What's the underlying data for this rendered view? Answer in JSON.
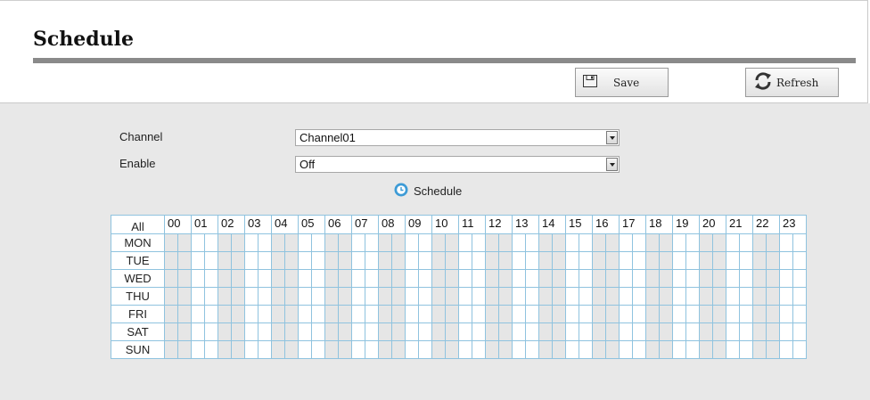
{
  "page": {
    "title": "Schedule"
  },
  "toolbar": {
    "save_label": "Save",
    "save_icon": "floppy-disk-icon",
    "refresh_label": "Refresh",
    "refresh_icon": "refresh-icon"
  },
  "form": {
    "channel": {
      "label": "Channel",
      "value": "Channel01"
    },
    "enable": {
      "label": "Enable",
      "value": "Off"
    },
    "schedule_link": {
      "label": "Schedule",
      "icon": "clock-icon"
    }
  },
  "grid": {
    "all_label": "All",
    "hours": [
      "00",
      "01",
      "02",
      "03",
      "04",
      "05",
      "06",
      "07",
      "08",
      "09",
      "10",
      "11",
      "12",
      "13",
      "14",
      "15",
      "16",
      "17",
      "18",
      "19",
      "20",
      "21",
      "22",
      "23"
    ],
    "days": [
      "MON",
      "TUE",
      "WED",
      "THU",
      "FRI",
      "SAT",
      "SUN"
    ]
  },
  "colors": {
    "accent_blue": "#3d9bd6",
    "grid_line": "#8fc3df",
    "title_rule": "#8a8a8a",
    "content_bg": "#e8e8e8"
  }
}
